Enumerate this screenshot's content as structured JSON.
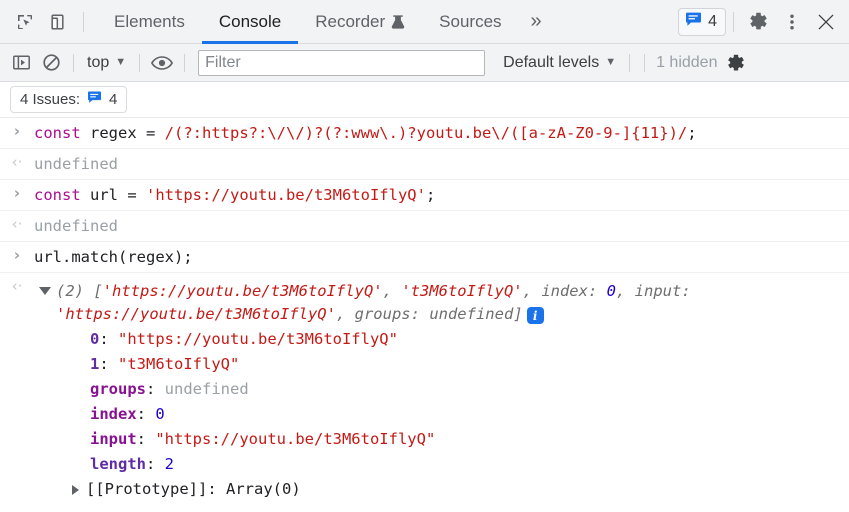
{
  "header": {
    "icons": [
      {
        "name": "inspect-element-icon",
        "title": "Inspect element"
      },
      {
        "name": "device-toolbar-icon",
        "title": "Toggle device toolbar"
      }
    ],
    "tabs": [
      {
        "label": "Elements",
        "active": false,
        "icon": null
      },
      {
        "label": "Console",
        "active": true,
        "icon": null
      },
      {
        "label": "Recorder",
        "active": false,
        "icon": "flask-icon"
      },
      {
        "label": "Sources",
        "active": false,
        "icon": null
      }
    ],
    "more_tabs_label": "»",
    "issues_count": "4",
    "settings_label": "Settings",
    "menu_label": "Customize and control DevTools",
    "close_label": "Close"
  },
  "toolbar": {
    "sidebar_toggle": "console-sidebar-toggle",
    "clear_console": "clear-console-icon",
    "context": "top",
    "context_caret": "▼",
    "eye_label": "create-live-expression",
    "filter_placeholder": "Filter",
    "filter_value": "",
    "levels_label": "Default levels",
    "levels_caret": "▼",
    "hidden_label": "1 hidden",
    "settings_label": "Console settings"
  },
  "issues_bar": {
    "label": "4 Issues:",
    "count": "4"
  },
  "console": {
    "entries": [
      {
        "type": "input",
        "marker": "›",
        "tokens": [
          {
            "t": "const",
            "c": "kw"
          },
          {
            "t": " regex = ",
            "c": "plain"
          },
          {
            "t": "/(?:https?:\\/\\/)?(?:www\\.)?youtu.be\\/([a-zA-Z0-9-]{11})/",
            "c": "regex"
          },
          {
            "t": ";",
            "c": "plain"
          }
        ]
      },
      {
        "type": "output",
        "marker": "‹·",
        "tokens": [
          {
            "t": "undefined",
            "c": "undef"
          }
        ]
      },
      {
        "type": "input",
        "marker": "›",
        "tokens": [
          {
            "t": "const",
            "c": "kw"
          },
          {
            "t": " url = ",
            "c": "plain"
          },
          {
            "t": "'https://youtu.be/t3M6toIflyQ'",
            "c": "str"
          },
          {
            "t": ";",
            "c": "plain"
          }
        ]
      },
      {
        "type": "output",
        "marker": "‹·",
        "tokens": [
          {
            "t": "undefined",
            "c": "undef"
          }
        ]
      },
      {
        "type": "input",
        "marker": "›",
        "tokens": [
          {
            "t": "url.match(regex);",
            "c": "plain"
          }
        ]
      }
    ],
    "result": {
      "marker": "‹·",
      "expanded": true,
      "preview_tokens": [
        {
          "t": "(2) ",
          "c": "grey"
        },
        {
          "t": "[",
          "c": "grey"
        },
        {
          "t": "'https://youtu.be/t3M6toIflyQ'",
          "c": "str"
        },
        {
          "t": ", ",
          "c": "grey"
        },
        {
          "t": "'t3M6toIflyQ'",
          "c": "str"
        },
        {
          "t": ", ",
          "c": "grey"
        },
        {
          "t": "index",
          "c": "grey"
        },
        {
          "t": ": ",
          "c": "grey"
        },
        {
          "t": "0",
          "c": "num"
        },
        {
          "t": ", ",
          "c": "grey"
        },
        {
          "t": "input",
          "c": "grey"
        },
        {
          "t": ": ",
          "c": "grey"
        },
        {
          "t": "'https://youtu.be/t3M6toIflyQ'",
          "c": "str"
        },
        {
          "t": ", ",
          "c": "grey"
        },
        {
          "t": "groups",
          "c": "grey"
        },
        {
          "t": ": ",
          "c": "grey"
        },
        {
          "t": "undefined",
          "c": "grey"
        },
        {
          "t": "]",
          "c": "grey"
        }
      ],
      "info_badge": "i",
      "properties": [
        {
          "key": "0",
          "key_class": "propkey",
          "sep": ": ",
          "value": "\"https://youtu.be/t3M6toIflyQ\"",
          "value_class": "str"
        },
        {
          "key": "1",
          "key_class": "propkey",
          "sep": ": ",
          "value": "\"t3M6toIflyQ\"",
          "value_class": "str"
        },
        {
          "key": "groups",
          "key_class": "prop",
          "sep": ": ",
          "value": "undefined",
          "value_class": "undef"
        },
        {
          "key": "index",
          "key_class": "prop",
          "sep": ": ",
          "value": "0",
          "value_class": "num"
        },
        {
          "key": "input",
          "key_class": "prop",
          "sep": ": ",
          "value": "\"https://youtu.be/t3M6toIflyQ\"",
          "value_class": "str"
        },
        {
          "key": "length",
          "key_class": "propkey",
          "sep": ": ",
          "value": "2",
          "value_class": "num"
        }
      ],
      "prototype": {
        "key": "[[Prototype]]",
        "sep": ": ",
        "value": "Array(0)"
      }
    }
  },
  "colors": {
    "accent_blue": "#1a73e8",
    "toolbar_bg": "#f1f3f4",
    "string_red": "#c41a16",
    "keyword_purple": "#aa0d91",
    "number_blue": "#1c00cf",
    "undefined_grey": "#9aa0a6"
  }
}
